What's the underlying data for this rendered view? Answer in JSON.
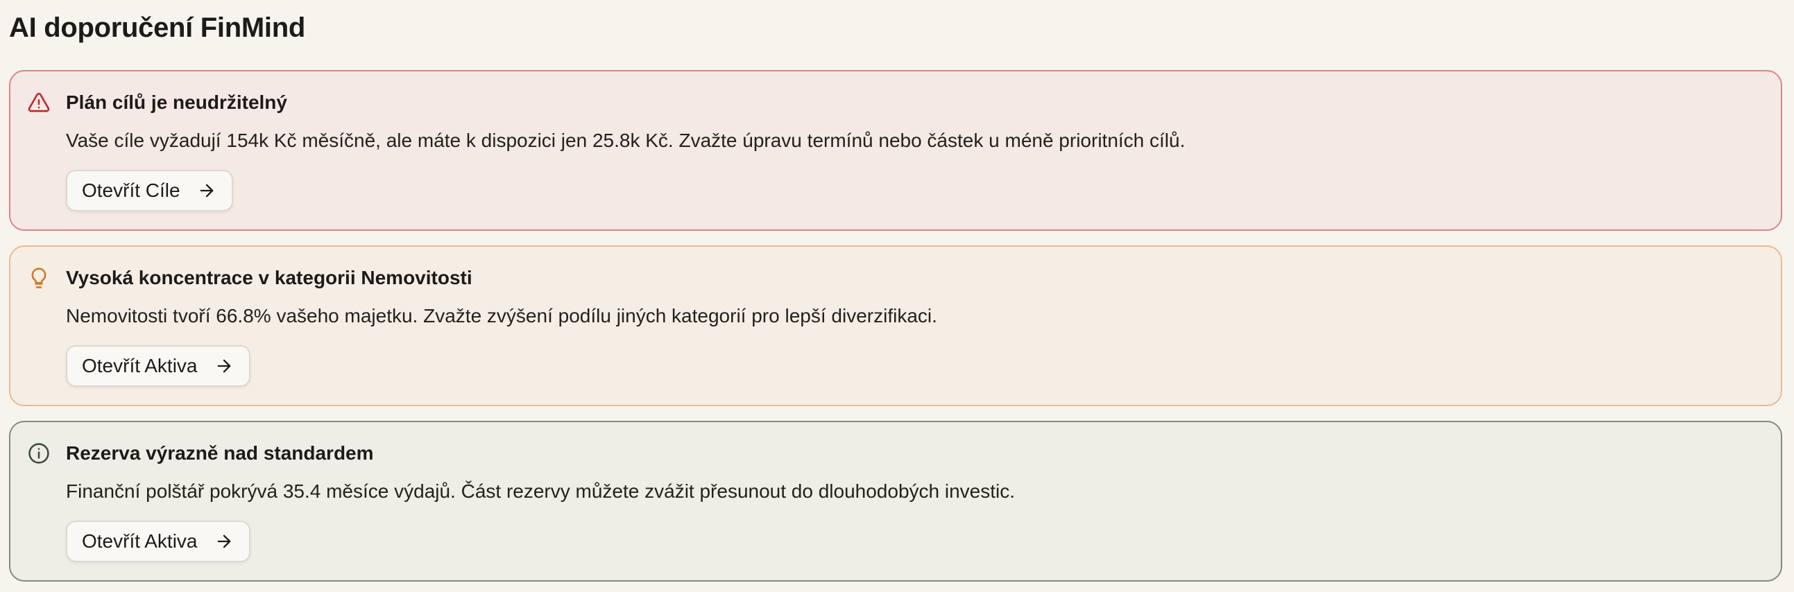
{
  "page": {
    "title": "AI doporučení FinMind"
  },
  "colors": {
    "background": "#f7f4ee",
    "critical_bg": "#f4e9e5",
    "critical_border": "#dc8585",
    "critical_icon": "#c0272d",
    "tip_bg": "#f6eee5",
    "tip_border": "#ebba91",
    "tip_icon": "#d07a2a",
    "info_bg": "#eeede6",
    "info_border": "#7e8e7c",
    "info_icon": "#3d4a3e"
  },
  "recommendations": [
    {
      "severity": "critical",
      "icon": "warning-triangle-icon",
      "title": "Plán cílů je neudržitelný",
      "text": "Vaše cíle vyžadují 154k Kč měsíčně, ale máte k dispozici jen 25.8k Kč. Zvažte úpravu termínů nebo částek u méně prioritních cílů.",
      "action_label": "Otevřít Cíle",
      "action_icon": "arrow-right-icon"
    },
    {
      "severity": "tip",
      "icon": "lightbulb-icon",
      "title": "Vysoká koncentrace v kategorii Nemovitosti",
      "text": "Nemovitosti tvoří 66.8% vašeho majetku. Zvažte zvýšení podílu jiných kategorií pro lepší diverzifikaci.",
      "action_label": "Otevřít Aktiva",
      "action_icon": "arrow-right-icon"
    },
    {
      "severity": "info",
      "icon": "info-circle-icon",
      "title": "Rezerva výrazně nad standardem",
      "text": "Finanční polštář pokrývá 35.4 měsíce výdajů. Část rezervy můžete zvážit přesunout do dlouhodobých investic.",
      "action_label": "Otevřít Aktiva",
      "action_icon": "arrow-right-icon"
    }
  ]
}
